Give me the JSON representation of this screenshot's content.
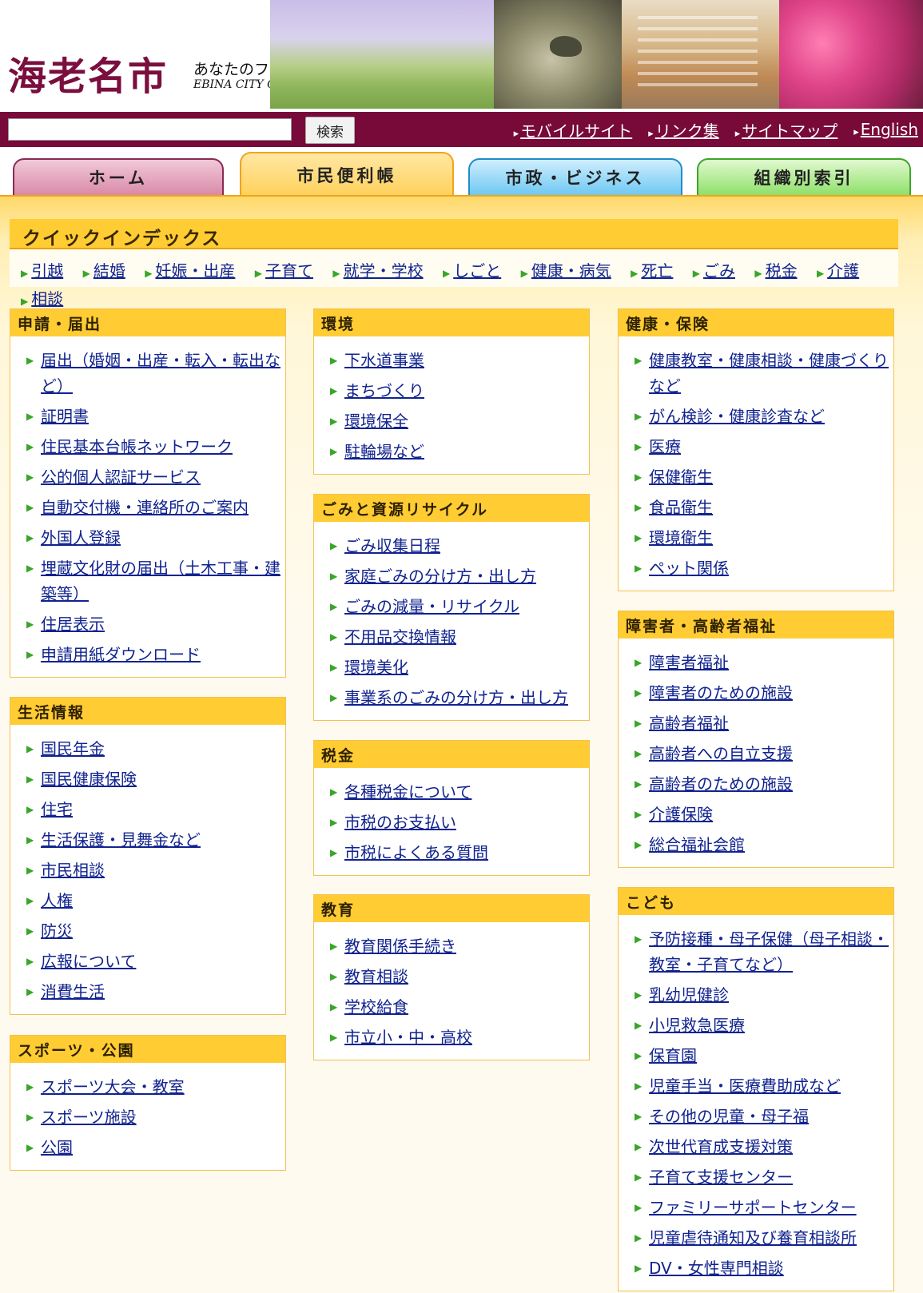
{
  "header": {
    "logo": "海老名市",
    "tagline": "あなたのフィールドへ。海老名市",
    "tagline_sub": "EBINA CITY Official Web Site"
  },
  "search": {
    "placeholder": "",
    "button_label": "検索"
  },
  "utility_links": [
    {
      "label": "モバイルサイト"
    },
    {
      "label": "リンク集"
    },
    {
      "label": "サイトマップ"
    },
    {
      "label": "English"
    }
  ],
  "tabs": [
    {
      "label": "ホーム",
      "color": "#d98aa8"
    },
    {
      "label": "市民便利帳",
      "color": "#ffd15a",
      "active": true
    },
    {
      "label": "市政・ビジネス",
      "color": "#6dc8f2"
    },
    {
      "label": "組織別索引",
      "color": "#8ee06a"
    }
  ],
  "quick_index": {
    "title": "クイックインデックス",
    "links": [
      "引越",
      "結婚",
      "妊娠・出産",
      "子育て",
      "就学・学校",
      "しごと",
      "健康・病気",
      "死亡",
      "ごみ",
      "税金",
      "介護",
      "相談"
    ]
  },
  "sections": {
    "shinsei": {
      "title": "申請・届出",
      "items": [
        "届出（婚姻・出産・転入・転出など）",
        "証明書",
        "住民基本台帳ネットワーク",
        "公的個人認証サービス",
        "自動交付機・連絡所のご案内",
        "外国人登録",
        "埋蔵文化財の届出（土木工事・建築等）",
        "住居表示",
        "申請用紙ダウンロード"
      ]
    },
    "seikatsu": {
      "title": "生活情報",
      "items": [
        "国民年金",
        "国民健康保険",
        "住宅",
        "生活保護・見舞金など",
        "市民相談",
        "人権",
        "防災",
        "広報について",
        "消費生活"
      ]
    },
    "sports": {
      "title": "スポーツ・公園",
      "items": [
        "スポーツ大会・教室",
        "スポーツ施設",
        "公園"
      ]
    },
    "kankyo": {
      "title": "環境",
      "items": [
        "下水道事業",
        "まちづくり",
        "環境保全",
        "駐輪場など"
      ]
    },
    "gomi": {
      "title": "ごみと資源リサイクル",
      "items": [
        "ごみ収集日程",
        "家庭ごみの分け方・出し方",
        "ごみの減量・リサイクル",
        "不用品交換情報",
        "環境美化",
        "事業系のごみの分け方・出し方"
      ]
    },
    "zeikin": {
      "title": "税金",
      "items": [
        "各種税金について",
        "市税のお支払い",
        "市税によくある質問"
      ]
    },
    "kyoiku": {
      "title": "教育",
      "items": [
        "教育関係手続き",
        "教育相談",
        "学校給食",
        "市立小・中・高校"
      ]
    },
    "kenko": {
      "title": "健康・保険",
      "items": [
        "健康教室・健康相談・健康づくりなど",
        "がん検診・健康診査など",
        "医療",
        "保健衛生",
        "食品衛生",
        "環境衛生",
        "ペット関係"
      ]
    },
    "fukushi": {
      "title": "障害者・高齢者福祉",
      "items": [
        "障害者福祉",
        "障害者のための施設",
        "高齢者福祉",
        "高齢者への自立支援",
        "高齢者のための施設",
        "介護保険",
        "総合福祉会館"
      ]
    },
    "kodomo": {
      "title": "こども",
      "items": [
        "予防接種・母子保健（母子相談・教室・子育てなど）",
        "乳幼児健診",
        "小児救急医療",
        "保育園",
        "児童手当・医療費助成など",
        "その他の児童・母子福",
        "次世代育成支援対策",
        "子育て支援センター",
        "ファミリーサポートセンター",
        "児童虐待通知及び養育相談所",
        "DV・女性専門相談"
      ]
    }
  }
}
